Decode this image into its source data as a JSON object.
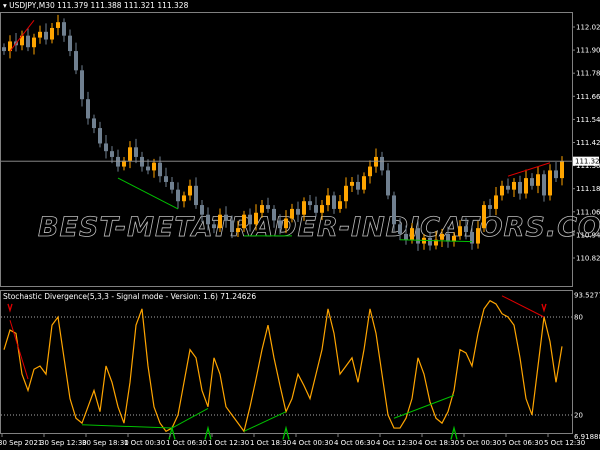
{
  "header": {
    "symbol": "USDJPY,M30",
    "ohlc": "111.379 111.388 111.321 111.328"
  },
  "indicator_title": "Stochastic Divergence(5,3,3 - Signal mode - Version: 1.6) 71.24626",
  "watermark": "BEST-METATRADER-INDICATORS.COM",
  "colors": {
    "bull": "#ffa500",
    "bear": "#708090",
    "stoch": "#ffa500",
    "bull_div": "#00c000",
    "bear_div": "#e00000",
    "grid": "#808080"
  },
  "chart_data": [
    {
      "type": "candlestick",
      "title": "USDJPY,M30",
      "ylim": [
        110.79,
        112.09
      ],
      "y_ticks": [
        "112.025",
        "111.905",
        "111.785",
        "111.665",
        "111.545",
        "111.425",
        "111.305",
        "111.185",
        "111.065",
        "110.945",
        "110.825"
      ],
      "current_price": "111.328",
      "close": [
        111.9,
        111.95,
        111.93,
        111.98,
        111.92,
        111.97,
        112.0,
        111.96,
        112.02,
        112.05,
        111.98,
        111.9,
        111.8,
        111.65,
        111.55,
        111.5,
        111.42,
        111.38,
        111.35,
        111.3,
        111.33,
        111.4,
        111.35,
        111.3,
        111.28,
        111.32,
        111.25,
        111.22,
        111.18,
        111.12,
        111.15,
        111.2,
        111.1,
        111.05,
        111.0,
        110.98,
        111.05,
        111.02,
        110.96,
        110.98,
        111.05,
        111.0,
        111.06,
        111.1,
        111.08,
        111.02,
        110.98,
        111.03,
        111.08,
        111.05,
        111.12,
        111.1,
        111.06,
        111.1,
        111.15,
        111.08,
        111.12,
        111.2,
        111.22,
        111.18,
        111.25,
        111.3,
        111.35,
        111.28,
        111.15,
        111.0,
        110.95,
        110.92,
        110.98,
        110.9,
        110.93,
        110.89,
        110.92,
        110.95,
        110.91,
        110.94,
        110.99,
        110.96,
        110.9,
        110.98,
        111.1,
        111.08,
        111.15,
        111.2,
        111.18,
        111.22,
        111.16,
        111.24,
        111.2,
        111.26,
        111.15,
        111.28,
        111.24,
        111.328
      ],
      "divergence_lines": [
        {
          "type": "bear",
          "from": [
            1,
            111.9
          ],
          "to": [
            5,
            112.06
          ]
        },
        {
          "type": "bull",
          "from": [
            19,
            111.24
          ],
          "to": [
            29,
            111.08
          ]
        },
        {
          "type": "bull",
          "from": [
            40,
            110.94
          ],
          "to": [
            48,
            110.94
          ]
        },
        {
          "type": "bull",
          "from": [
            66,
            110.92
          ],
          "to": [
            78,
            110.91
          ]
        },
        {
          "type": "bear",
          "from": [
            84,
            111.25
          ],
          "to": [
            91,
            111.32
          ]
        }
      ]
    },
    {
      "type": "line",
      "title": "Stochastic Divergence(5,3,3 - Signal mode - Version: 1.6) 71.24626",
      "ylim": [
        6.91888,
        93.52773
      ],
      "y_ticks": [
        "93.52773",
        "80",
        "20",
        "6.91888"
      ],
      "levels": [
        80,
        20
      ],
      "values": [
        60,
        72,
        70,
        45,
        35,
        48,
        50,
        45,
        75,
        80,
        55,
        30,
        18,
        15,
        25,
        35,
        22,
        50,
        40,
        25,
        15,
        40,
        75,
        85,
        50,
        25,
        15,
        10,
        12,
        20,
        40,
        60,
        55,
        35,
        25,
        55,
        45,
        25,
        20,
        15,
        10,
        25,
        42,
        60,
        75,
        55,
        38,
        22,
        30,
        45,
        38,
        30,
        45,
        60,
        85,
        70,
        45,
        50,
        55,
        40,
        60,
        85,
        70,
        45,
        20,
        12,
        12,
        18,
        30,
        55,
        45,
        28,
        18,
        15,
        22,
        35,
        60,
        58,
        50,
        70,
        85,
        90,
        88,
        82,
        80,
        75,
        55,
        30,
        20,
        50,
        80,
        65,
        40,
        62
      ],
      "divergence_lines": [
        {
          "type": "bear",
          "from": [
            1,
            78
          ],
          "to": [
            4,
            42
          ]
        },
        {
          "type": "bull",
          "from": [
            13,
            14
          ],
          "to": [
            28,
            12
          ]
        },
        {
          "type": "bull",
          "from": [
            28,
            12
          ],
          "to": [
            34,
            24
          ]
        },
        {
          "type": "bull",
          "from": [
            40,
            10
          ],
          "to": [
            47,
            22
          ]
        },
        {
          "type": "bull",
          "from": [
            65,
            18
          ],
          "to": [
            75,
            32
          ]
        },
        {
          "type": "bear",
          "from": [
            83,
            93
          ],
          "to": [
            90,
            80
          ]
        }
      ],
      "arrows": [
        {
          "type": "bear",
          "index": 1
        },
        {
          "type": "bull",
          "index": 28
        },
        {
          "type": "bull",
          "index": 34
        },
        {
          "type": "bull",
          "index": 47
        },
        {
          "type": "bull",
          "index": 75
        },
        {
          "type": "bear",
          "index": 90
        }
      ]
    }
  ],
  "time_axis": [
    {
      "index": 1,
      "label": "30 Sep 2021"
    },
    {
      "index": 8,
      "label": "30 Sep 12:30"
    },
    {
      "index": 15,
      "label": "30 Sep 18:30"
    },
    {
      "index": 22,
      "label": "1 Oct 00:30"
    },
    {
      "index": 29,
      "label": "1 Oct 06:30"
    },
    {
      "index": 36,
      "label": "1 Oct 12:30"
    },
    {
      "index": 43,
      "label": "1 Oct 18:30"
    },
    {
      "index": 50,
      "label": "4 Oct 00:30"
    },
    {
      "index": 57,
      "label": "4 Oct 06:30"
    },
    {
      "index": 64,
      "label": "4 Oct 12:30"
    },
    {
      "index": 71,
      "label": "4 Oct 18:30"
    },
    {
      "index": 78,
      "label": "5 Oct 00:30"
    },
    {
      "index": 85,
      "label": "5 Oct 06:30"
    },
    {
      "index": 92,
      "label": "5 Oct 12:30"
    }
  ]
}
